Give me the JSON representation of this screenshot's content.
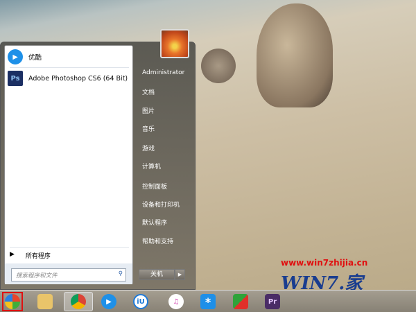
{
  "start_menu": {
    "programs": [
      {
        "label": "优酷",
        "icon": "youku-icon"
      },
      {
        "label": "Adobe Photoshop CS6 (64 Bit)",
        "icon": "photoshop-icon",
        "icon_text": "Ps"
      }
    ],
    "all_programs": "所有程序",
    "search_placeholder": "搜索程序和文件",
    "user": "Administrator",
    "right_items": [
      "文档",
      "图片",
      "音乐",
      "游戏",
      "计算机",
      "控制面板",
      "设备和打印机",
      "默认程序",
      "帮助和支持"
    ],
    "shutdown": "关机"
  },
  "taskbar": {
    "apps": [
      "explorer",
      "chrome",
      "youku",
      "iqiyi-assistant",
      "itunes",
      "baidu-assistant",
      "wps",
      "premiere"
    ],
    "premiere_text": "Pr",
    "iu_text": "iU"
  },
  "watermark": {
    "url": "www.win7zhijia.cn",
    "logo": "WIN7.家"
  }
}
